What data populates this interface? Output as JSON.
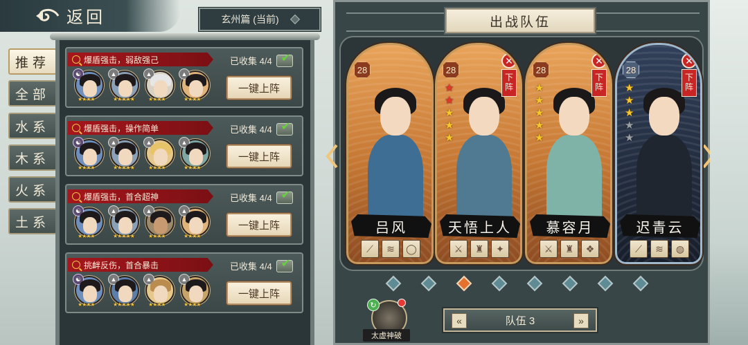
{
  "header": {
    "back_label": "返回",
    "chapter_label": "玄州篇 (当前)"
  },
  "tabs": [
    {
      "label": "推荐",
      "active": true
    },
    {
      "label": "全部",
      "active": false
    },
    {
      "label": "水系",
      "active": false
    },
    {
      "label": "木系",
      "active": false
    },
    {
      "label": "火系",
      "active": false
    },
    {
      "label": "土系",
      "active": false
    }
  ],
  "recommended_teams": [
    {
      "description": "爆盾强击，弱敌强己",
      "collected": "已收集 4/4",
      "button": "一键上阵",
      "avatar_stars": [
        4,
        5,
        4,
        4
      ]
    },
    {
      "description": "爆盾强击，操作简单",
      "collected": "已收集 4/4",
      "button": "一键上阵",
      "avatar_stars": [
        4,
        5,
        4,
        4
      ]
    },
    {
      "description": "爆盾强击，首合超神",
      "collected": "已收集 4/4",
      "button": "一键上阵",
      "avatar_stars": [
        4,
        5,
        4,
        4
      ]
    },
    {
      "description": "挑衅反伤，首合暴击",
      "collected": "已收集 4/4",
      "button": "一键上阵",
      "avatar_stars": [
        4,
        5,
        4,
        4
      ]
    }
  ],
  "battle_team": {
    "title": "出战队伍",
    "heroes": [
      {
        "name": "吕风",
        "level": "28",
        "stars": [],
        "removable": false,
        "style": "orange",
        "equip_icons": [
          "spear-icon",
          "scroll-icon",
          "ring-icon"
        ]
      },
      {
        "name": "天悟上人",
        "level": "28",
        "stars": [
          "red",
          "red",
          "gold",
          "gold",
          "gold"
        ],
        "removable": true,
        "remove_label": "下阵",
        "style": "orange",
        "equip_icons": [
          "sword-icon",
          "armor-icon",
          "amulet-icon"
        ]
      },
      {
        "name": "慕容月",
        "level": "28",
        "stars": [
          "gold",
          "gold",
          "gold",
          "gold",
          "gold"
        ],
        "removable": true,
        "remove_label": "下阵",
        "style": "orange",
        "equip_icons": [
          "sword-icon",
          "armor-icon",
          "jade-icon"
        ]
      },
      {
        "name": "迟青云",
        "level": "28",
        "stars": [
          "gold",
          "gold",
          "gold",
          "grey",
          "grey"
        ],
        "removable": true,
        "remove_label": "下阵",
        "style": "blue",
        "equip_icons": [
          "spear-icon",
          "scroll-icon",
          "bell-icon"
        ]
      }
    ],
    "page_dots": 8,
    "active_dot": 2,
    "team_label": "队伍 3"
  },
  "skill": {
    "label": "太虚神破"
  }
}
